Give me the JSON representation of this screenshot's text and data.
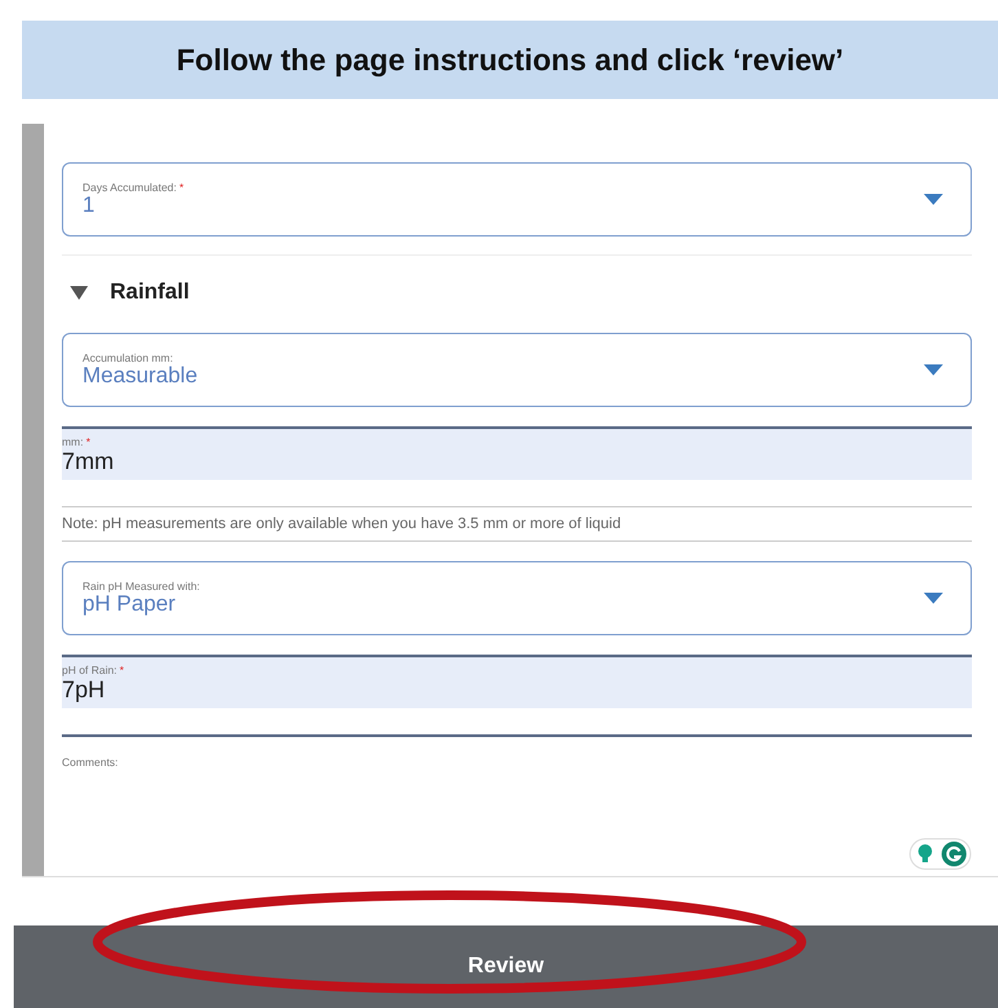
{
  "instruction": "Follow the page instructions and click ‘review’",
  "fields": [
    {
      "kind": "select",
      "label": "Days Accumulated:",
      "required_mark": "*",
      "value": "1"
    },
    {
      "kind": "section",
      "label": "Rainfall",
      "expanded": true
    },
    {
      "kind": "select",
      "label": "Accumulation mm:",
      "value": "Measurable"
    },
    {
      "kind": "text",
      "label": "mm:",
      "required_mark": "*",
      "value": "7mm"
    },
    {
      "kind": "note",
      "label": "Note: pH measurements are only available when you have 3.5 mm or more of liquid"
    },
    {
      "kind": "select",
      "label": "Rain pH Measured with:",
      "value": "pH Paper"
    },
    {
      "kind": "text",
      "label": "pH of Rain:",
      "required_mark": "*",
      "value": "7pH"
    },
    {
      "kind": "textarea",
      "label": "Comments:"
    }
  ],
  "review_button": "Review",
  "highlight": true
}
